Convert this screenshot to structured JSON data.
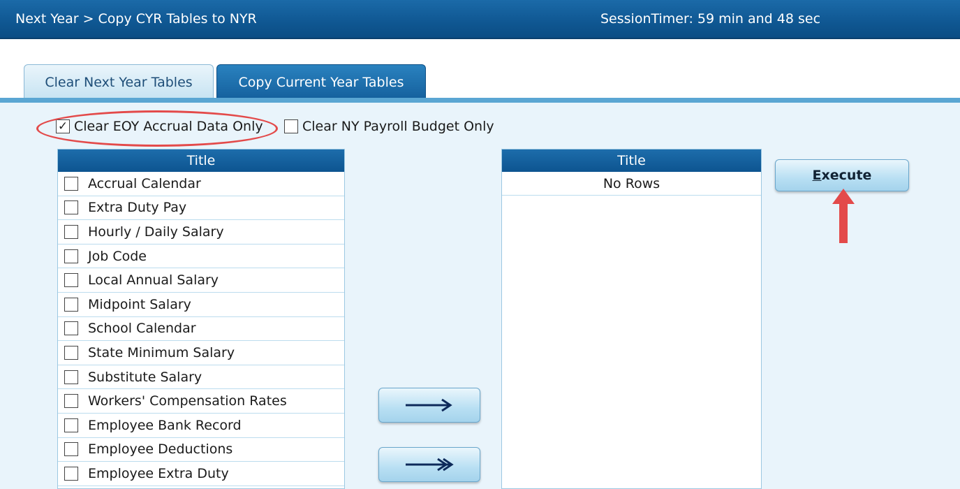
{
  "header": {
    "breadcrumb": "Next Year > Copy CYR Tables to NYR",
    "session_timer": "SessionTimer: 59 min and 48 sec"
  },
  "tabs": [
    {
      "label": "Clear Next Year Tables",
      "active": true
    },
    {
      "label": "Copy Current Year Tables",
      "active": false
    }
  ],
  "options": {
    "clear_eoy": {
      "label": "Clear EOY Accrual Data Only",
      "checked": true
    },
    "clear_ny_payroll": {
      "label": "Clear NY Payroll Budget Only",
      "checked": false
    }
  },
  "left_grid": {
    "header": "Title",
    "rows": [
      "Accrual Calendar",
      "Extra Duty Pay",
      "Hourly / Daily Salary",
      "Job Code",
      "Local Annual Salary",
      "Midpoint Salary",
      "School Calendar",
      "State Minimum Salary",
      "Substitute Salary",
      "Workers' Compensation Rates",
      "Employee Bank Record",
      "Employee Deductions",
      "Employee Extra Duty"
    ]
  },
  "right_grid": {
    "header": "Title",
    "empty_text": "No Rows"
  },
  "buttons": {
    "execute_hotkey": "E",
    "execute_rest": "xecute",
    "move_selected_glyph": "⟶",
    "move_all_glyph": "↠"
  },
  "colors": {
    "header_blue": "#0f5792",
    "panel": "#e9f4fb",
    "annotation_red": "#e34a4a"
  }
}
